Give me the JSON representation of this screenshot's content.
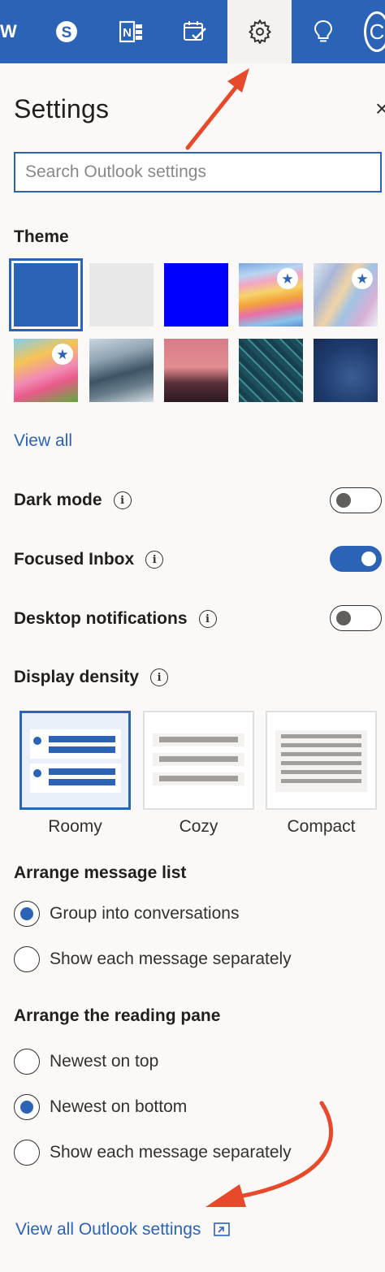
{
  "topbar": {
    "partial_label": "W",
    "avatar_initial": "C",
    "icons": [
      "skype-icon",
      "onenote-icon",
      "todo-icon",
      "settings-gear-icon",
      "lightbulb-icon"
    ],
    "bar_color": "#2b63b7"
  },
  "panel": {
    "title": "Settings",
    "close_glyph": "×",
    "search": {
      "placeholder": "Search Outlook settings",
      "value": ""
    }
  },
  "theme": {
    "label": "Theme",
    "view_all": "View all",
    "swatches": [
      {
        "name": "blue",
        "selected": true,
        "premium": false
      },
      {
        "name": "light-gray",
        "selected": false,
        "premium": false
      },
      {
        "name": "bright-blue",
        "selected": false,
        "premium": false
      },
      {
        "name": "rainbow",
        "selected": false,
        "premium": true
      },
      {
        "name": "ribbons",
        "selected": false,
        "premium": true
      },
      {
        "name": "unicorn",
        "selected": false,
        "premium": true
      },
      {
        "name": "mountain",
        "selected": false,
        "premium": false
      },
      {
        "name": "palms",
        "selected": false,
        "premium": false
      },
      {
        "name": "circuit",
        "selected": false,
        "premium": false
      },
      {
        "name": "innovation",
        "selected": false,
        "premium": false
      }
    ]
  },
  "toggles": {
    "dark_mode": {
      "label": "Dark mode",
      "on": false
    },
    "focused_inbox": {
      "label": "Focused Inbox",
      "on": true
    },
    "desktop_notifications": {
      "label": "Desktop notifications",
      "on": false
    }
  },
  "density": {
    "label": "Display density",
    "options": [
      {
        "label": "Roomy",
        "selected": true
      },
      {
        "label": "Cozy",
        "selected": false
      },
      {
        "label": "Compact",
        "selected": false
      }
    ]
  },
  "message_list": {
    "label": "Arrange message list",
    "options": [
      {
        "label": "Group into conversations",
        "checked": true
      },
      {
        "label": "Show each message separately",
        "checked": false
      }
    ]
  },
  "reading_pane": {
    "label": "Arrange the reading pane",
    "options": [
      {
        "label": "Newest on top",
        "checked": false
      },
      {
        "label": "Newest on bottom",
        "checked": true
      },
      {
        "label": "Show each message separately",
        "checked": false
      }
    ]
  },
  "footer": {
    "view_all_settings": "View all Outlook settings"
  },
  "colors": {
    "accent": "#2b63b7",
    "annotation_arrow": "#e8492b"
  }
}
